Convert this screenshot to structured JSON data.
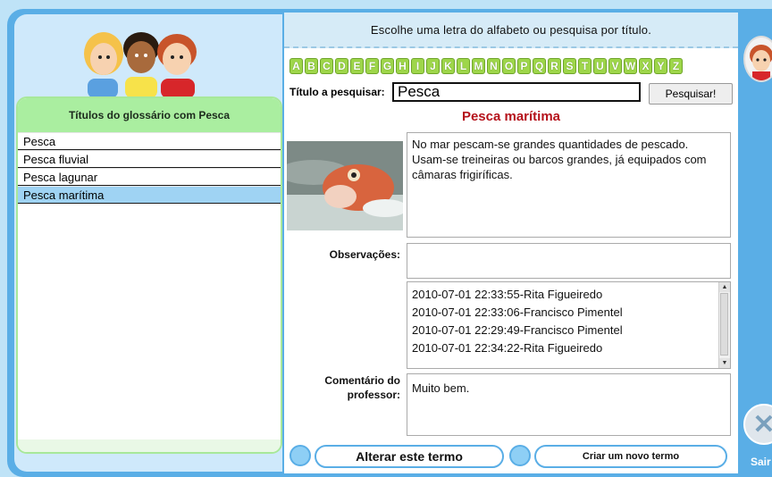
{
  "header": {
    "instruction": "Escolhe uma letra do alfabeto ou pesquisa por título."
  },
  "alphabet": [
    "A",
    "B",
    "C",
    "D",
    "E",
    "F",
    "G",
    "H",
    "I",
    "J",
    "K",
    "L",
    "M",
    "N",
    "O",
    "P",
    "Q",
    "R",
    "S",
    "T",
    "U",
    "V",
    "W",
    "X",
    "Y",
    "Z"
  ],
  "search": {
    "label": "Título a pesquisar:",
    "value": "Pesca",
    "button_label": "Pesquisar!"
  },
  "sidebar": {
    "title": "Títulos do glossário com Pesca",
    "items": [
      {
        "label": "Pesca"
      },
      {
        "label": "Pesca fluvial"
      },
      {
        "label": "Pesca lagunar"
      },
      {
        "label": "Pesca marítima"
      }
    ],
    "selected_index": 3
  },
  "term": {
    "title": "Pesca marítima",
    "description": "No mar pescam-se grandes quantidades de pescado. Usam-se treineiras ou barcos grandes, já equipados com câmaras frigiríficas.",
    "observations_label": "Observações:",
    "observations_value": "",
    "history": [
      "2010-07-01 22:33:55-Rita Figueiredo",
      "2010-07-01 22:33:06-Francisco Pimentel",
      "2010-07-01 22:29:49-Francisco Pimentel",
      "2010-07-01 22:34:22-Rita Figueiredo"
    ],
    "comment_label_line1": "Comentário do",
    "comment_label_line2": "professor:",
    "comment_value": "Muito bem."
  },
  "actions": {
    "edit_label": "Alterar este termo",
    "new_label": "Criar um novo termo"
  },
  "exit": {
    "label": "Sair"
  },
  "colors": {
    "accent": "#5aaee6",
    "letter": "#9ed64a",
    "title": "#b5121b",
    "selected": "#9fd3f3"
  }
}
